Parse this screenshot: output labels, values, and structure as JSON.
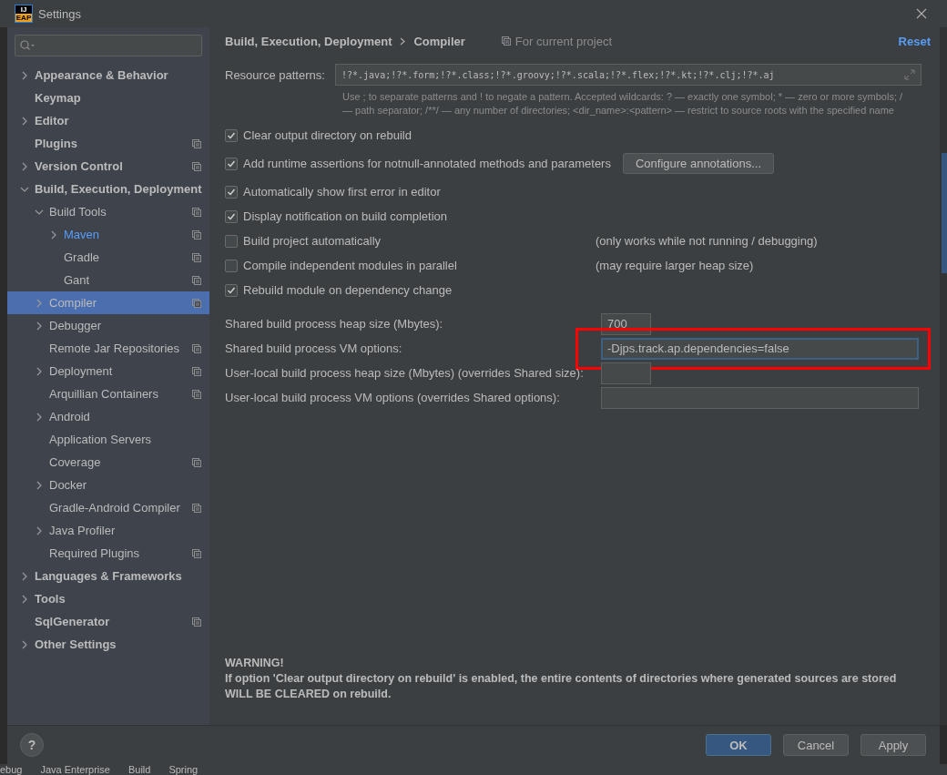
{
  "window": {
    "title": "Settings",
    "app_badge": "IJ",
    "app_badge_sub": "EAP"
  },
  "sidebar": {
    "items": [
      {
        "label": "Appearance & Behavior",
        "expanded": false
      },
      {
        "label": "Keymap"
      },
      {
        "label": "Editor",
        "expanded": false
      },
      {
        "label": "Plugins",
        "scoped": true
      },
      {
        "label": "Version Control",
        "expanded": false,
        "scoped": true
      },
      {
        "label": "Build, Execution, Deployment",
        "expanded": true,
        "children": [
          {
            "label": "Build Tools",
            "expanded": true,
            "scoped": true,
            "children": [
              {
                "label": "Maven",
                "expanded": false,
                "scoped": true,
                "modified": true
              },
              {
                "label": "Gradle",
                "scoped": true
              },
              {
                "label": "Gant",
                "scoped": true
              }
            ]
          },
          {
            "label": "Compiler",
            "expanded": false,
            "scoped": true,
            "selected": true
          },
          {
            "label": "Debugger",
            "expanded": false
          },
          {
            "label": "Remote Jar Repositories",
            "scoped": true
          },
          {
            "label": "Deployment",
            "expanded": false,
            "scoped": true
          },
          {
            "label": "Arquillian Containers",
            "scoped": true
          },
          {
            "label": "Android",
            "expanded": false
          },
          {
            "label": "Application Servers"
          },
          {
            "label": "Coverage",
            "scoped": true
          },
          {
            "label": "Docker",
            "expanded": false
          },
          {
            "label": "Gradle-Android Compiler",
            "scoped": true
          },
          {
            "label": "Java Profiler",
            "expanded": false
          },
          {
            "label": "Required Plugins",
            "scoped": true
          }
        ]
      },
      {
        "label": "Languages & Frameworks",
        "expanded": false
      },
      {
        "label": "Tools",
        "expanded": false
      },
      {
        "label": "SqlGenerator",
        "scoped": true
      },
      {
        "label": "Other Settings",
        "expanded": false
      }
    ]
  },
  "header": {
    "breadcrumb": [
      "Build, Execution, Deployment",
      "Compiler"
    ],
    "scope_note": "For current project",
    "reset": "Reset"
  },
  "resource_patterns": {
    "label": "Resource patterns:",
    "value": "!?*.java;!?*.form;!?*.class;!?*.groovy;!?*.scala;!?*.flex;!?*.kt;!?*.clj;!?*.aj",
    "hint": "Use ; to separate patterns and ! to negate a pattern. Accepted wildcards: ? — exactly one symbol; * — zero or more symbols; / — path separator; /**/ — any number of directories; <dir_name>:<pattern> — restrict to source roots with the specified name"
  },
  "options": [
    {
      "label": "Clear output directory on rebuild",
      "checked": true
    },
    {
      "label": "Add runtime assertions for notnull-annotated methods and parameters",
      "checked": true,
      "button": "Configure annotations..."
    },
    {
      "label": "Automatically show first error in editor",
      "checked": true
    },
    {
      "label": "Display notification on build completion",
      "checked": true
    },
    {
      "label": "Build project automatically",
      "checked": false,
      "note": "(only works while not running / debugging)"
    },
    {
      "label": "Compile independent modules in parallel",
      "checked": false,
      "note": "(may require larger heap size)"
    },
    {
      "label": "Rebuild module on dependency change",
      "checked": true
    }
  ],
  "fields": [
    {
      "label": "Shared build process heap size (Mbytes):",
      "value": "700",
      "kind": "short",
      "highlighted": false
    },
    {
      "label": "Shared build process VM options:",
      "value": "-Djps.track.ap.dependencies=false",
      "kind": "wide",
      "highlighted": true
    },
    {
      "label": "User-local build process heap size (Mbytes) (overrides Shared size):",
      "kind": "short",
      "highlighted": false
    },
    {
      "label": "User-local build process VM options (overrides Shared options):",
      "kind": "wide",
      "highlighted": false
    }
  ],
  "warning": {
    "title": "WARNING!",
    "text": "If option 'Clear output directory on rebuild' is enabled, the entire contents of directories where generated sources are stored WILL BE CLEARED on rebuild."
  },
  "footer": {
    "help": "?",
    "buttons": [
      {
        "label": "OK",
        "primary": true
      },
      {
        "label": "Cancel",
        "primary": false
      },
      {
        "label": "Apply",
        "primary": false
      }
    ]
  },
  "background_tool_tabs": [
    "ebug",
    "Java Enterprise",
    "Build",
    "Spring"
  ]
}
